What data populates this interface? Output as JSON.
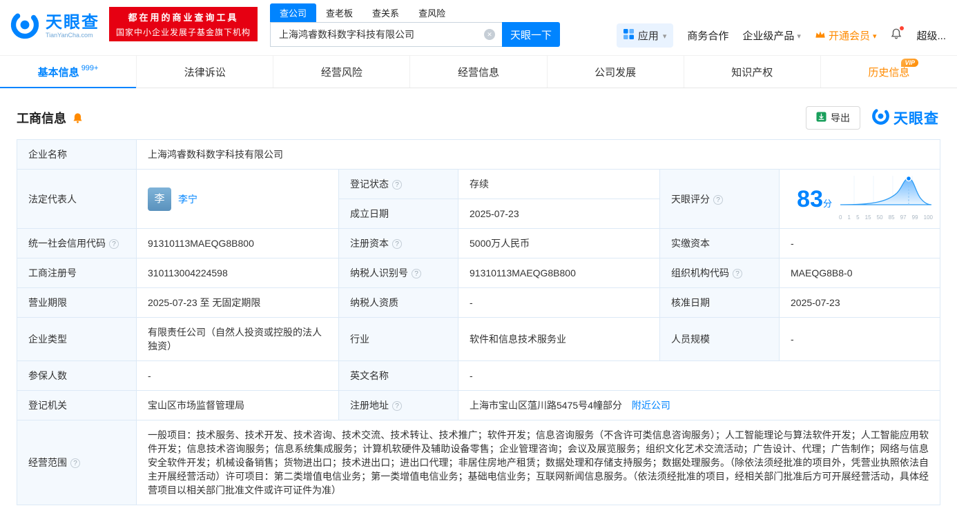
{
  "header": {
    "logo": {
      "title": "天眼查",
      "subtitle": "TianYanCha.com"
    },
    "promo": {
      "line1": "都在用的商业查询工具",
      "line2": "国家中小企业发展子基金旗下机构"
    },
    "search": {
      "tabs": [
        {
          "label": "查公司"
        },
        {
          "label": "查老板"
        },
        {
          "label": "查关系"
        },
        {
          "label": "查风险"
        }
      ],
      "value": "上海鸿睿数科数字科技有限公司",
      "button": "天眼一下"
    },
    "menu": {
      "apps": "应用",
      "cooperation": "商务合作",
      "enterprise": "企业级产品",
      "vip": "开通会员",
      "super": "超级..."
    }
  },
  "tabs": [
    {
      "label": "基本信息",
      "badge": "999+"
    },
    {
      "label": "法律诉讼"
    },
    {
      "label": "经营风险"
    },
    {
      "label": "经营信息"
    },
    {
      "label": "公司发展"
    },
    {
      "label": "知识产权"
    },
    {
      "label": "历史信息",
      "vip": "VIP"
    }
  ],
  "section": {
    "title": "工商信息",
    "export": "导出",
    "brand": "天眼查"
  },
  "business": {
    "company_name": {
      "label": "企业名称",
      "value": "上海鸿睿数科数字科技有限公司"
    },
    "legal_rep": {
      "label": "法定代表人",
      "avatar": "李",
      "name": "李宁"
    },
    "reg_status": {
      "label": "登记状态",
      "value": "存续"
    },
    "establish_date": {
      "label": "成立日期",
      "value": "2025-07-23"
    },
    "score": {
      "label": "天眼评分",
      "value": "83",
      "unit": "分",
      "ticks": [
        "0",
        "1",
        "5",
        "15",
        "50",
        "85",
        "97",
        "99",
        "100"
      ]
    },
    "credit_code": {
      "label": "统一社会信用代码",
      "value": "91310113MAEQG8B800"
    },
    "reg_capital": {
      "label": "注册资本",
      "value": "5000万人民币"
    },
    "paid_capital": {
      "label": "实缴资本",
      "value": "-"
    },
    "reg_number": {
      "label": "工商注册号",
      "value": "310113004224598"
    },
    "taxpayer_id": {
      "label": "纳税人识别号",
      "value": "91310113MAEQG8B800"
    },
    "org_code": {
      "label": "组织机构代码",
      "value": "MAEQG8B8-0"
    },
    "business_term": {
      "label": "营业期限",
      "value": "2025-07-23 至 无固定期限"
    },
    "taxpayer_quality": {
      "label": "纳税人资质",
      "value": "-"
    },
    "approval_date": {
      "label": "核准日期",
      "value": "2025-07-23"
    },
    "company_type": {
      "label": "企业类型",
      "value": "有限责任公司（自然人投资或控股的法人独资）"
    },
    "industry": {
      "label": "行业",
      "value": "软件和信息技术服务业"
    },
    "staff_size": {
      "label": "人员规模",
      "value": "-"
    },
    "insured_count": {
      "label": "参保人数",
      "value": "-"
    },
    "english_name": {
      "label": "英文名称",
      "value": "-"
    },
    "reg_authority": {
      "label": "登记机关",
      "value": "宝山区市场监督管理局"
    },
    "reg_address": {
      "label": "注册地址",
      "value": "上海市宝山区蕰川路5475号4幢部分",
      "nearby": "附近公司"
    },
    "business_scope": {
      "label": "经营范围",
      "value": "一般项目：技术服务、技术开发、技术咨询、技术交流、技术转让、技术推广；软件开发；信息咨询服务（不含许可类信息咨询服务）；人工智能理论与算法软件开发；人工智能应用软件开发；信息技术咨询服务；信息系统集成服务；计算机软硬件及辅助设备零售；企业管理咨询；会议及展览服务；组织文化艺术交流活动；广告设计、代理；广告制作；网络与信息安全软件开发；机械设备销售；货物进出口；技术进出口；进出口代理；非居住房地产租赁；数据处理和存储支持服务；数据处理服务。（除依法须经批准的项目外，凭营业执照依法自主开展经营活动）许可项目：第二类增值电信业务；第一类增值电信业务；基础电信业务；互联网新闻信息服务。（依法须经批准的项目，经相关部门批准后方可开展经营活动，具体经营项目以相关部门批准文件或许可证件为准）"
    }
  }
}
